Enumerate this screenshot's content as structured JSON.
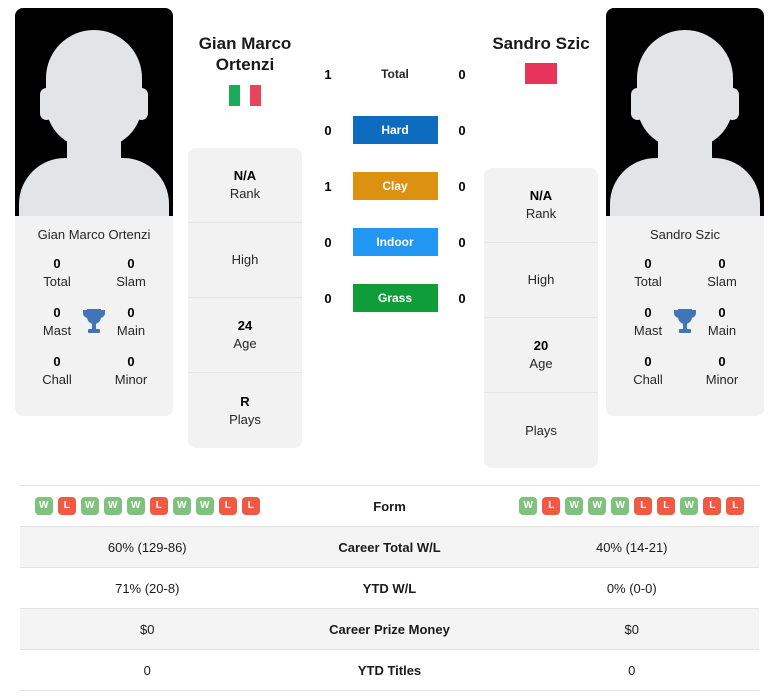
{
  "players": {
    "left": {
      "name_line1": "Gian Marco",
      "name_line2": "Ortenzi",
      "card_name": "Gian Marco Ortenzi",
      "flag_name": "italy-flag",
      "flag_bands": [
        "#1aab5b",
        "#ffffff",
        "#e8445c"
      ],
      "titles": {
        "total_value": "0",
        "total_label": "Total",
        "slam_value": "0",
        "slam_label": "Slam",
        "mast_value": "0",
        "mast_label": "Mast",
        "main_value": "0",
        "main_label": "Main",
        "chall_value": "0",
        "chall_label": "Chall",
        "minor_value": "0",
        "minor_label": "Minor"
      },
      "info": {
        "rank_value": "N/A",
        "rank_label": "Rank",
        "high_value": "",
        "high_label": "High",
        "age_value": "24",
        "age_label": "Age",
        "plays_value": "R",
        "plays_label": "Plays"
      }
    },
    "right": {
      "name_line1": "Sandro Szic",
      "name_line2": "",
      "card_name": "Sandro Szic",
      "flag_name": "red-flag",
      "flag_bands": [
        "#e8345a",
        "#e8345a",
        "#e8345a"
      ],
      "titles": {
        "total_value": "0",
        "total_label": "Total",
        "slam_value": "0",
        "slam_label": "Slam",
        "mast_value": "0",
        "mast_label": "Mast",
        "main_value": "0",
        "main_label": "Main",
        "chall_value": "0",
        "chall_label": "Chall",
        "minor_value": "0",
        "minor_label": "Minor"
      },
      "info": {
        "rank_value": "N/A",
        "rank_label": "Rank",
        "high_value": "",
        "high_label": "High",
        "age_value": "20",
        "age_label": "Age",
        "plays_value": "",
        "plays_label": "Plays"
      }
    }
  },
  "head_to_head": {
    "rows": [
      {
        "label": "Total",
        "left": "1",
        "right": "0",
        "color": "",
        "style": "plain"
      },
      {
        "label": "Hard",
        "left": "0",
        "right": "0",
        "color": "#0d6cbf",
        "style": "bar"
      },
      {
        "label": "Clay",
        "left": "1",
        "right": "0",
        "color": "#dd9110",
        "style": "bar"
      },
      {
        "label": "Indoor",
        "left": "0",
        "right": "0",
        "color": "#2196f3",
        "style": "bar"
      },
      {
        "label": "Grass",
        "left": "0",
        "right": "0",
        "color": "#0f9d3a",
        "style": "bar"
      }
    ]
  },
  "form_colors": {
    "win": "#7ec27e",
    "loss": "#ef5a42"
  },
  "stats": {
    "rows": [
      {
        "label": "Form",
        "type": "form",
        "left_form": [
          "W",
          "L",
          "W",
          "W",
          "W",
          "L",
          "W",
          "W",
          "L",
          "L"
        ],
        "right_form": [
          "W",
          "L",
          "W",
          "W",
          "W",
          "L",
          "L",
          "W",
          "L",
          "L"
        ]
      },
      {
        "label": "Career Total W/L",
        "type": "text",
        "left": "60% (129-86)",
        "right": "40% (14-21)"
      },
      {
        "label": "YTD W/L",
        "type": "text",
        "left": "71% (20-8)",
        "right": "0% (0-0)"
      },
      {
        "label": "Career Prize Money",
        "type": "text",
        "left": "$0",
        "right": "$0"
      },
      {
        "label": "YTD Titles",
        "type": "text",
        "left": "0",
        "right": "0"
      }
    ]
  }
}
